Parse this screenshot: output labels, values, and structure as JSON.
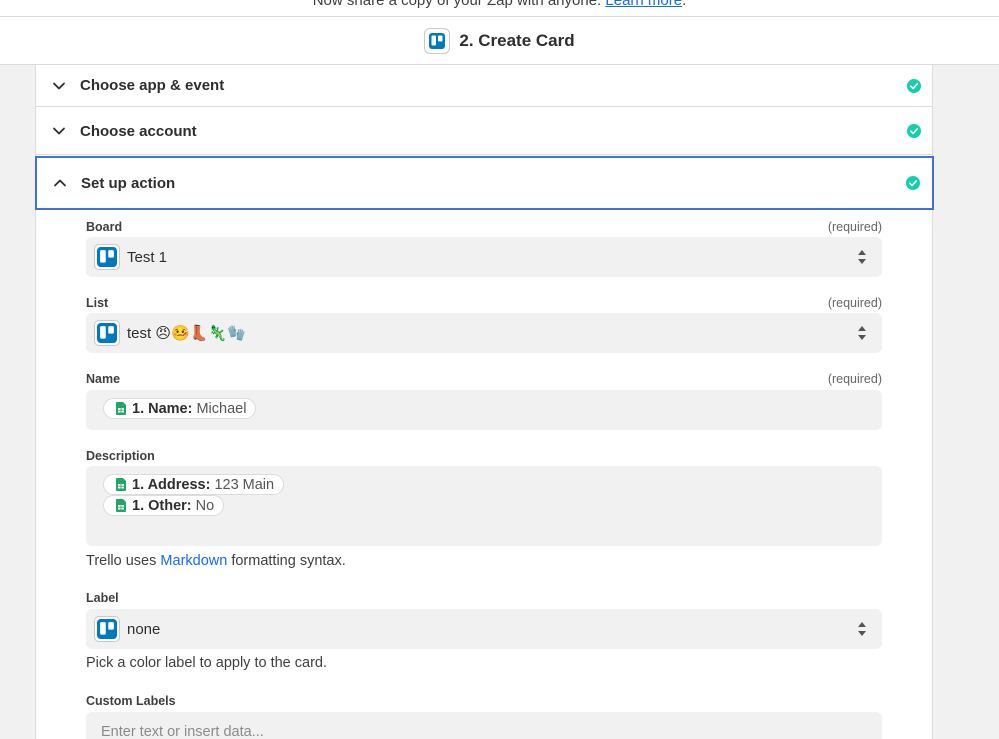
{
  "notice": {
    "text": "Now share a copy of your Zap with anyone.",
    "link": "Learn more",
    "end": "."
  },
  "header": {
    "title": "2. Create Card",
    "icon": "trello-icon"
  },
  "sections": [
    {
      "label": "Choose app & event",
      "status": "complete"
    },
    {
      "label": "Choose account",
      "status": "complete"
    },
    {
      "label": "Set up action",
      "status": "complete"
    }
  ],
  "form": {
    "required_text": "(required)",
    "board": {
      "label": "Board",
      "value": "Test 1"
    },
    "list": {
      "label": "List",
      "value": "test 😠🤒👢🦎🧤"
    },
    "name": {
      "label": "Name",
      "tokens": [
        {
          "key": "1. Name:",
          "value": "Michael"
        }
      ]
    },
    "description": {
      "label": "Description",
      "tokens": [
        {
          "key": "1. Address:",
          "value": "123 Main"
        },
        {
          "key": "1. Other:",
          "value": "No"
        }
      ]
    },
    "markdown_help": {
      "before": "Trello uses",
      "link": "Markdown",
      "after": "formatting syntax."
    },
    "label": {
      "label": "Label",
      "value": "none",
      "help": "Pick a color label to apply to the card."
    },
    "custom_labels": {
      "label": "Custom Labels",
      "placeholder": "Enter text or insert data..."
    }
  },
  "colors": {
    "accent": "#3d73d6",
    "success": "#13d0ab",
    "trello": "#0079bf",
    "sheets": "#23a566",
    "link": "#136bf5"
  }
}
